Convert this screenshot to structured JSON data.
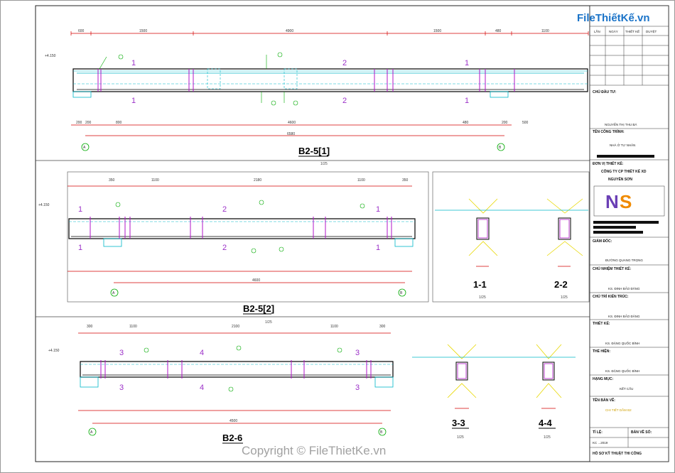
{
  "brand": {
    "logo": "FileThiếtKế.vn",
    "watermark": "Copyright © FileThietKe.vn"
  },
  "titleblock": {
    "header_cols": [
      "LẦN",
      "NGÀY",
      "THIẾT KẾ",
      "DUYỆT"
    ],
    "owner_label": "CHỦ ĐẦU TƯ:",
    "owner_name": "NGUYỄN THỊ THU BÁ",
    "project_label": "TÊN CÔNG TRÌNH:",
    "project_name": "NHÀ Ở TƯ NHÂN",
    "design_unit_label": "ĐƠN VỊ THIẾT KẾ:",
    "company": "CÔNG TY CP THIẾT KẾ XD",
    "company2": "NGUYỄN SƠN",
    "director_label": "GIÁM ĐỐC:",
    "director_name": "ĐƯỜNG QUANG TRỌNG",
    "chief_design_label": "CHỦ NHIỆM THIẾT KẾ:",
    "chief_design_name": "KS. ĐINH BẢO ĐĂNG",
    "chief_tech_label": "CHỦ TRÌ KIẾN TRÚC:",
    "chief_tech_name": "KS. ĐINH BẢO ĐĂNG",
    "designer_label": "THIẾT KẾ:",
    "designer_name": "KS. ĐẶNG QUỐC BÌNH",
    "drafter_label": "THỂ HIỆN:",
    "drafter_name": "KS. ĐẶNG QUỐC BÌNH",
    "category_label": "HẠNG MỤC:",
    "category_name": "KẾT CẤU",
    "drawing_label": "TÊN BẢN VẼ:",
    "drawing_name": "CHI TIẾT DẦM B2",
    "scale_label": "TỈ LỆ:",
    "sheet_label": "BẢN VẼ SỐ:",
    "date_label": "KC ...2019",
    "footer": "HỒ SƠ KỸ THUẬT THI CÔNG"
  },
  "beams": {
    "b1": {
      "title": "B2-5[1]",
      "scale": "1/25",
      "dims_top": [
        "600",
        "1500",
        "4900",
        "1500",
        "480",
        "1100"
      ],
      "dims_bottom": [
        "200",
        "200",
        "800",
        "4600",
        "480",
        "200",
        "500"
      ],
      "total": "6580",
      "elev": "+4.150",
      "axes": [
        "A",
        "B"
      ]
    },
    "b2": {
      "title": "B2-5[2]",
      "scale": "1/25",
      "dims_top": [
        "350",
        "1100",
        "2180",
        "1100",
        "350"
      ],
      "total": "4600",
      "elev": "+4.150",
      "axes": [
        "A",
        "B"
      ]
    },
    "b3": {
      "title": "B2-6",
      "scale": "1/25",
      "dims_top": [
        "300",
        "1100",
        "2100",
        "1100",
        "300"
      ],
      "total": "4500",
      "elev": "+4.150",
      "axes": [
        "A",
        "B"
      ]
    }
  },
  "sections": [
    {
      "title": "1-1",
      "scale": "1/25"
    },
    {
      "title": "2-2",
      "scale": "1/25"
    },
    {
      "title": "3-3",
      "scale": "1/25"
    },
    {
      "title": "4-4",
      "scale": "1/25"
    }
  ],
  "section_marks": [
    "1",
    "2",
    "3",
    "4"
  ],
  "colors": {
    "beam": "#000000",
    "dim": "#d40000",
    "rebar": "#b014c8",
    "cyan": "#00b8c8",
    "green": "#00aa00",
    "yellow": "#e8d800"
  }
}
